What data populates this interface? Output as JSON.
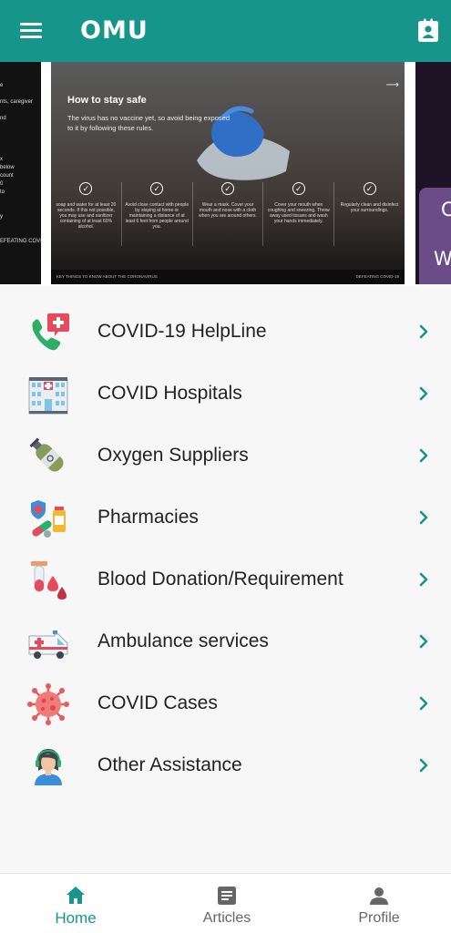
{
  "header": {
    "logo_text": "OMU",
    "menu_icon": "hamburger-menu-icon",
    "right_icon": "contact-badge-icon",
    "color": "#16968a"
  },
  "carousel": {
    "left_slide_lines": [
      "e",
      "",
      "nts, caregiver",
      "",
      "nd",
      "",
      "",
      "",
      "",
      "x",
      "below",
      "count",
      "0",
      "to",
      "",
      "",
      "y",
      "",
      "",
      "EFEATING COVID-19"
    ],
    "main_slide": {
      "title": "How to stay safe",
      "subtitle": "The virus has no vaccine yet, so avoid being exposed to it by following these rules.",
      "tips": [
        "soap and water for at least 20 seconds. If this not possible, you may use and sanitizer containing of at least 60% alcohol.",
        "Avoid close contact with people by staying at home or maintaining a distance of at least 6 feet from people around you.",
        "Wear a mask. Cover your mouth and nose with a cloth when you are around others.",
        "Cover your mouth when coughing and sneezing. Throw away used tissues and wash your hands immediately.",
        "Regularly clean and disinfect your surroundings."
      ],
      "footer_left": "KEY THINGS TO KNOW ABOUT THE CORONAVIRUS",
      "footer_right": "DEFEATING COVID-19"
    },
    "right_slide_letters": [
      "C",
      "W"
    ]
  },
  "services": [
    {
      "label": "COVID-19 HelpLine",
      "icon": "phone-medical-icon"
    },
    {
      "label": "COVID Hospitals",
      "icon": "hospital-icon"
    },
    {
      "label": "Oxygen Suppliers",
      "icon": "oxygen-cylinder-icon"
    },
    {
      "label": "Pharmacies",
      "icon": "pharmacy-icon"
    },
    {
      "label": "Blood Donation/Requirement",
      "icon": "blood-drop-icon"
    },
    {
      "label": "Ambulance services",
      "icon": "ambulance-icon"
    },
    {
      "label": "COVID Cases",
      "icon": "virus-icon"
    },
    {
      "label": "Other Assistance",
      "icon": "assistant-icon"
    }
  ],
  "bottom_nav": [
    {
      "label": "Home",
      "icon": "home-icon",
      "active": true
    },
    {
      "label": "Articles",
      "icon": "articles-icon",
      "active": false
    },
    {
      "label": "Profile",
      "icon": "profile-icon",
      "active": false
    }
  ]
}
